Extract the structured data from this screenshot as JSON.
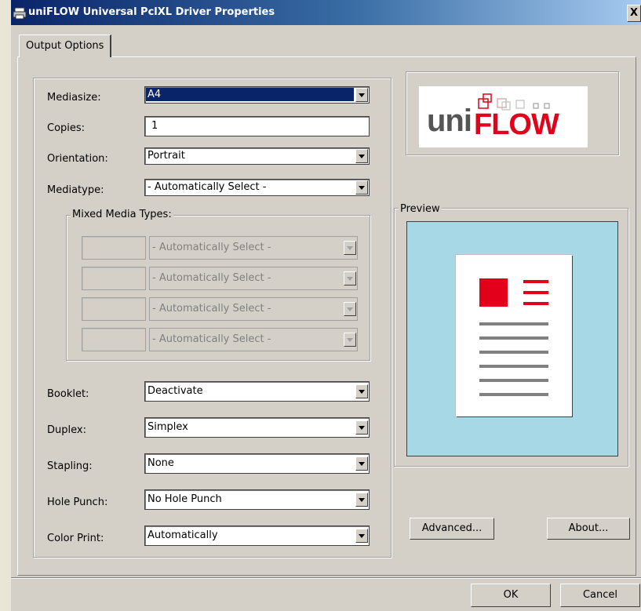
{
  "window": {
    "title": "uniFLOW Universal PclXL Driver Properties",
    "close_glyph": "X"
  },
  "tabs": [
    {
      "label": "Output Options"
    }
  ],
  "form": {
    "mediasize": {
      "label": "Mediasize:",
      "value": "A4"
    },
    "copies": {
      "label": "Copies:",
      "value": "1"
    },
    "orientation": {
      "label": "Orientation:",
      "value": "Portrait"
    },
    "mediatype": {
      "label": "Mediatype:",
      "value": "- Automatically Select -"
    },
    "mixed_media": {
      "legend": "Mixed Media Types:",
      "rows": [
        {
          "value": "- Automatically Select -"
        },
        {
          "value": "- Automatically Select -"
        },
        {
          "value": "- Automatically Select -"
        },
        {
          "value": "- Automatically Select -"
        }
      ]
    },
    "booklet": {
      "label": "Booklet:",
      "value": "Deactivate"
    },
    "duplex": {
      "label": "Duplex:",
      "value": "Simplex"
    },
    "stapling": {
      "label": "Stapling:",
      "value": "None"
    },
    "hole_punch": {
      "label": "Hole Punch:",
      "value": "No Hole Punch"
    },
    "color_print": {
      "label": "Color Print:",
      "value": "Automatically"
    }
  },
  "logo": {
    "text_uni": "uni",
    "text_flow": "FLOW"
  },
  "preview": {
    "legend": "Preview"
  },
  "buttons": {
    "advanced": "Advanced...",
    "about": "About...",
    "ok": "OK",
    "cancel": "Cancel"
  },
  "colors": {
    "logo_red": "#e2001a",
    "logo_grey": "#555555",
    "preview_bg": "#a6d8e6",
    "title_blue": "#0a246a"
  }
}
